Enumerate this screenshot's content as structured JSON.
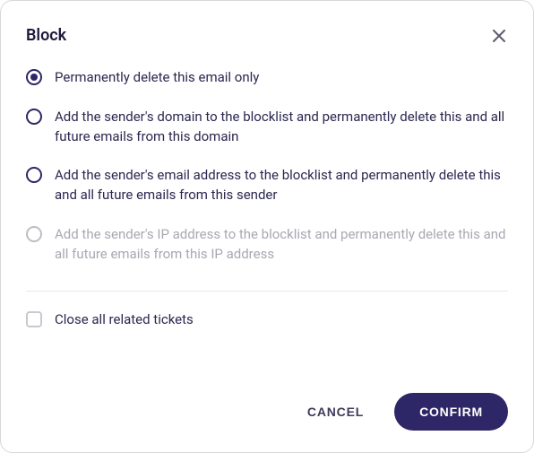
{
  "dialog": {
    "title": "Block",
    "options": [
      {
        "label": "Permanently delete this email only",
        "selected": true,
        "disabled": false
      },
      {
        "label": "Add the sender's domain to the blocklist and permanently delete this and all future emails from this domain",
        "selected": false,
        "disabled": false
      },
      {
        "label": "Add the sender's email address to the blocklist and permanently delete this and all future emails from this sender",
        "selected": false,
        "disabled": false
      },
      {
        "label": "Add the sender's IP address to the blocklist and permanently delete this and all future emails from this IP address",
        "selected": false,
        "disabled": true
      }
    ],
    "checkbox": {
      "label": "Close all related tickets",
      "checked": false
    },
    "buttons": {
      "cancel": "CANCEL",
      "confirm": "CONFIRM"
    }
  }
}
